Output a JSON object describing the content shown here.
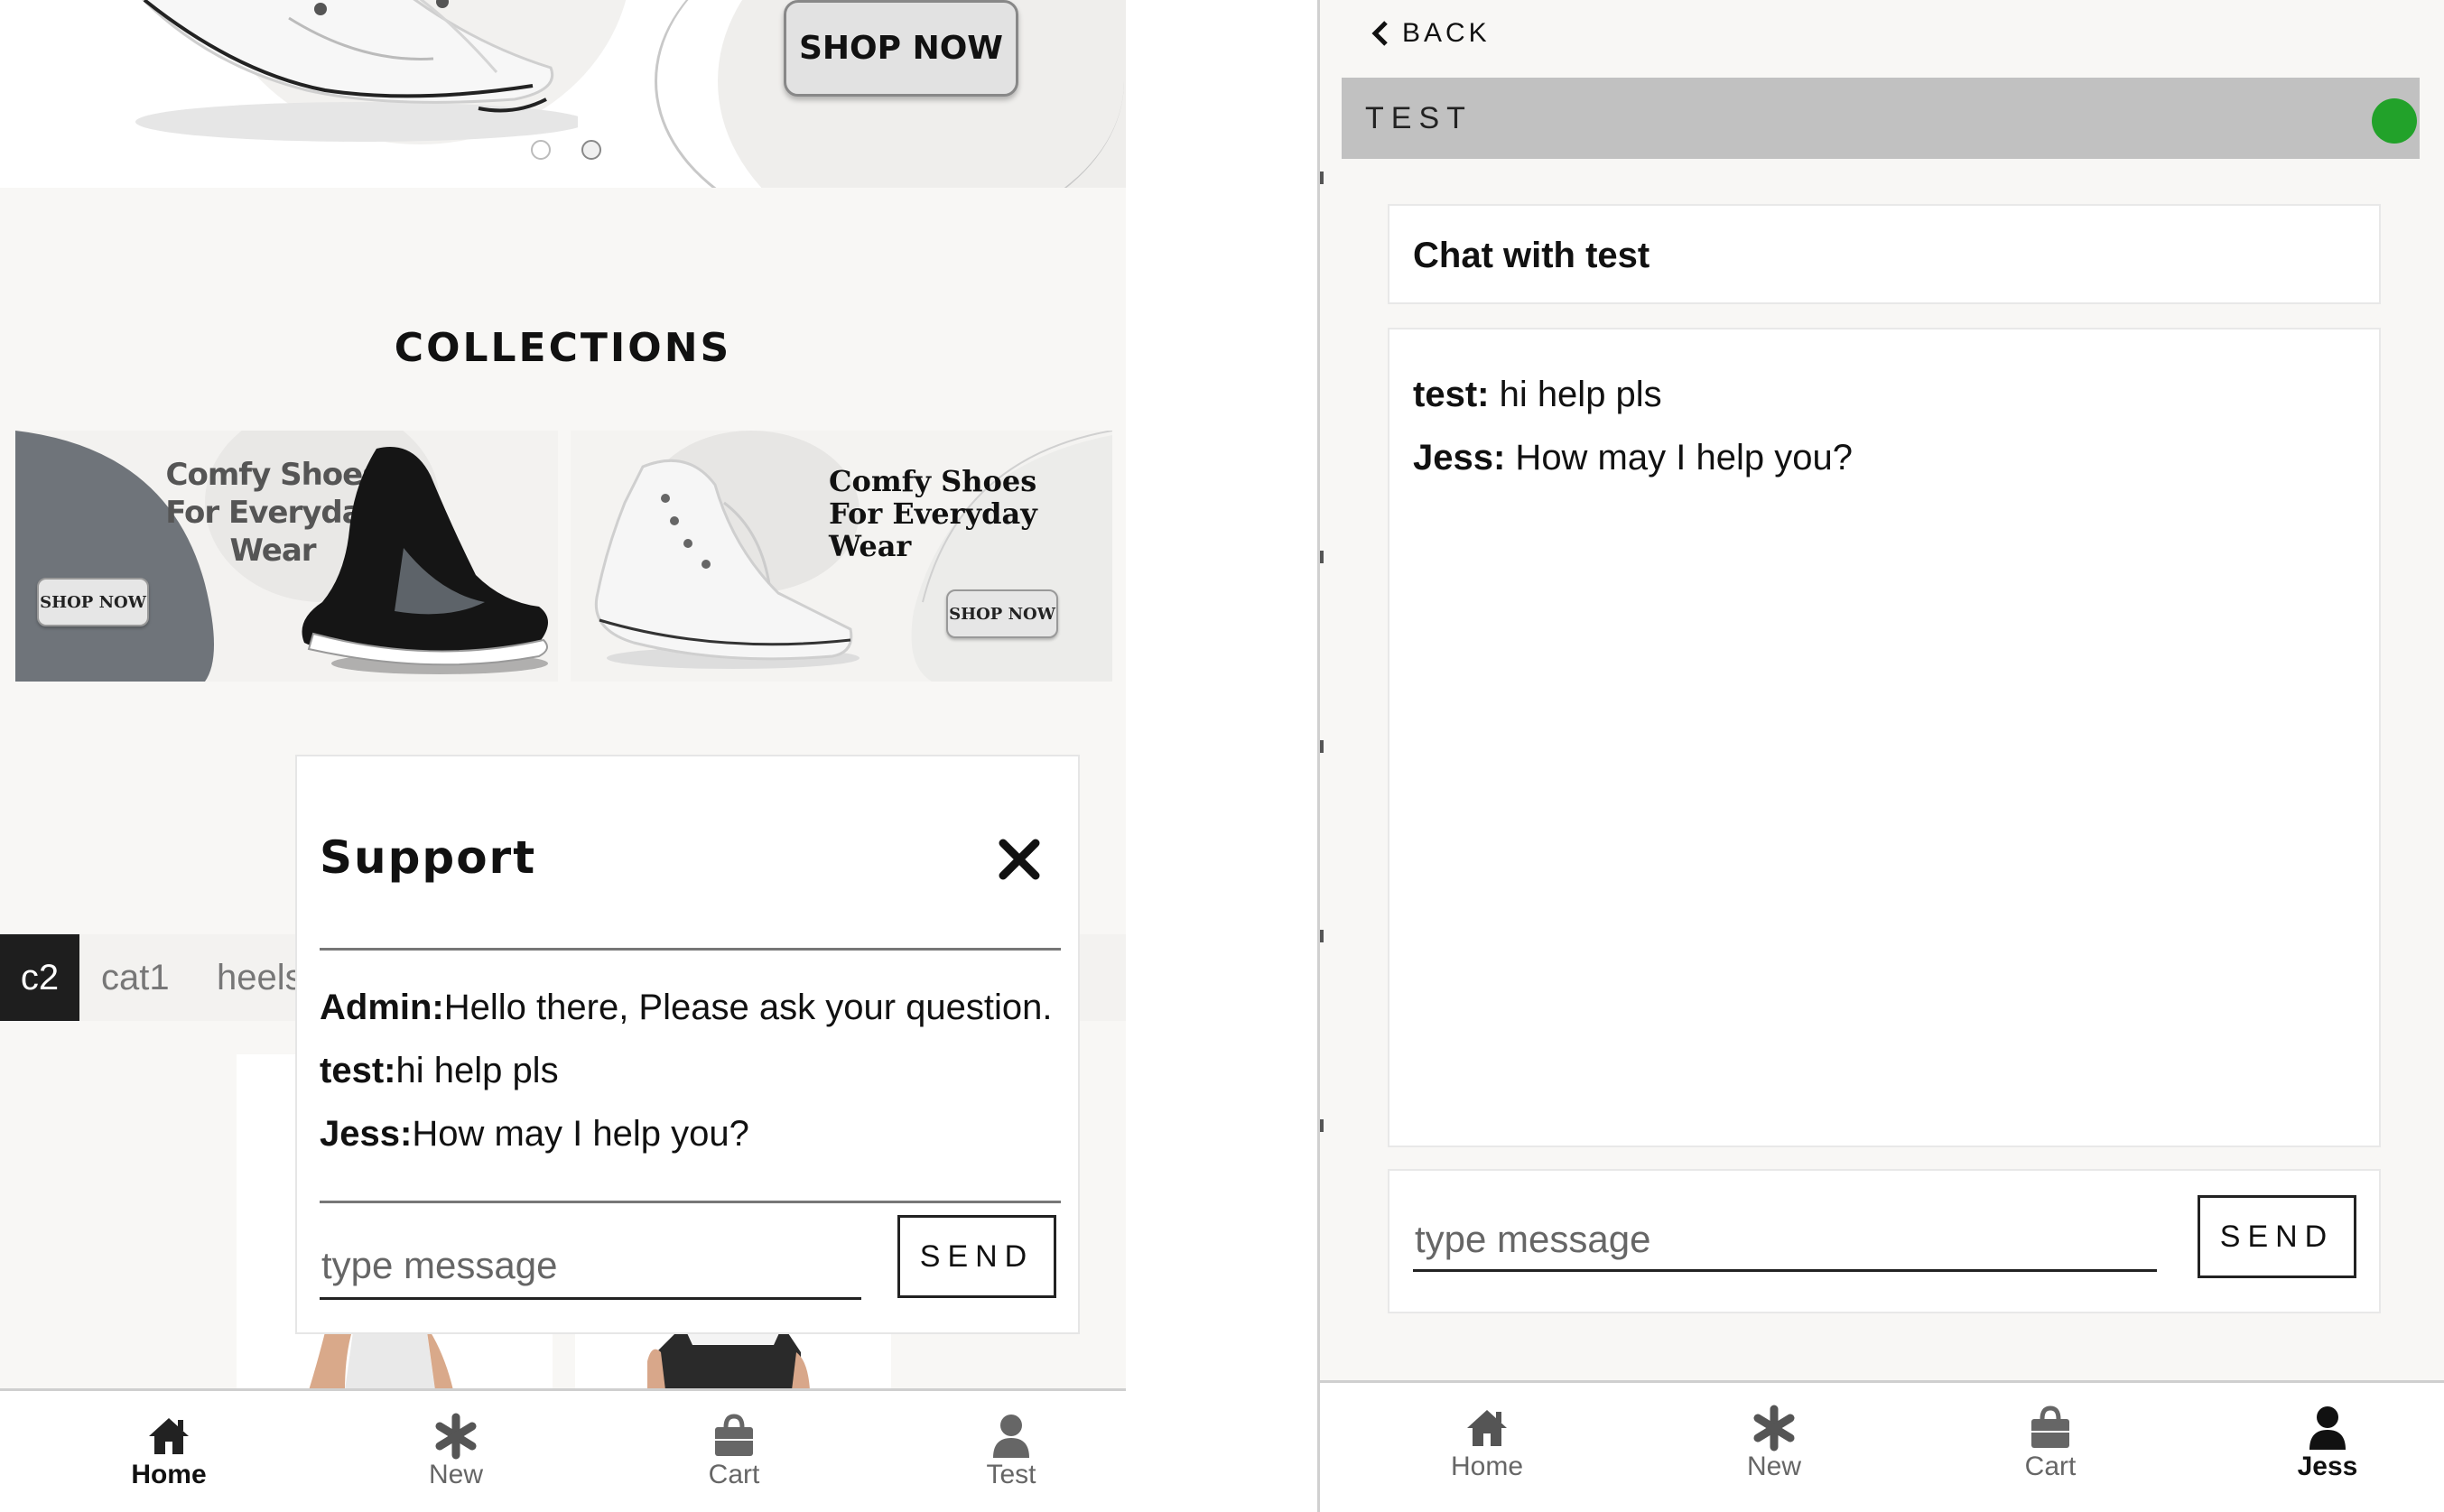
{
  "left_panel": {
    "hero": {
      "shop_button": "SHOP NOW"
    },
    "collections": {
      "title": "COLLECTIONS",
      "banners": [
        {
          "text_lines": [
            "Comfy Shoes",
            "For Everyday",
            "Wear"
          ],
          "button": "SHOP NOW"
        },
        {
          "text_lines": [
            "Comfy Shoes",
            "For Everyday",
            "Wear"
          ],
          "button": "SHOP NOW"
        }
      ]
    },
    "categories": [
      {
        "label": "c2",
        "active": true
      },
      {
        "label": "cat1",
        "active": false
      },
      {
        "label": "heels",
        "active": false
      }
    ],
    "support": {
      "title": "Support",
      "messages": [
        {
          "sender": "Admin:",
          "text": "Hello there, Please ask your question."
        },
        {
          "sender": "test:",
          "text": "hi help pls"
        },
        {
          "sender": "Jess:",
          "text": "How may I help you?"
        }
      ],
      "input_placeholder": "type message",
      "send_label": "SEND"
    },
    "bottom_nav": [
      {
        "label": "Home",
        "icon": "home-icon",
        "active": true
      },
      {
        "label": "New",
        "icon": "asterisk-icon",
        "active": false
      },
      {
        "label": "Cart",
        "icon": "shopping-bag-icon",
        "active": false
      },
      {
        "label": "Test",
        "icon": "user-icon",
        "active": false
      }
    ]
  },
  "right_panel": {
    "back_label": "BACK",
    "header_title": "TEST",
    "status_color": "#22a22a",
    "chat_title": "Chat with test",
    "messages": [
      {
        "sender": "test:",
        "text": " hi help pls"
      },
      {
        "sender": "Jess:",
        "text": " How may I help you?"
      }
    ],
    "input_placeholder": "type message",
    "send_label": "SEND",
    "bottom_nav": [
      {
        "label": "Home",
        "icon": "home-icon",
        "active": false
      },
      {
        "label": "New",
        "icon": "asterisk-icon",
        "active": false
      },
      {
        "label": "Cart",
        "icon": "shopping-bag-icon",
        "active": false
      },
      {
        "label": "Jess",
        "icon": "user-icon",
        "active": true
      }
    ]
  },
  "colors": {
    "accent_green": "#22a22a",
    "header_gray": "#c1c1c1",
    "category_active_bg": "#1e1e1e"
  }
}
